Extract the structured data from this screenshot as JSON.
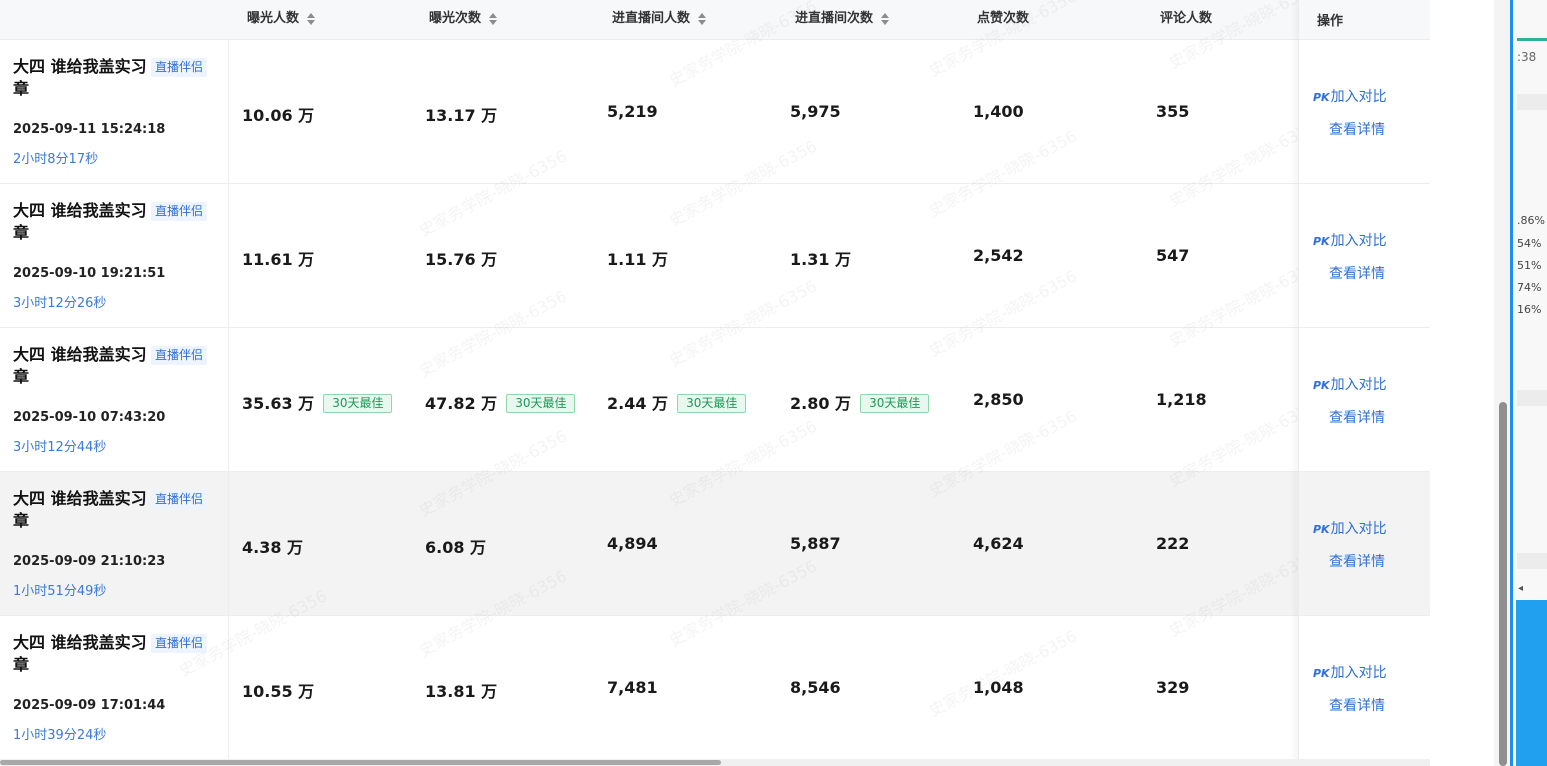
{
  "columns": {
    "exposure_users": "曝光人数",
    "exposure_count": "曝光次数",
    "enter_users": "进直播间人数",
    "enter_count": "进直播间次数",
    "likes": "点赞次数",
    "comment_users": "评论人数",
    "actions": "操作"
  },
  "rows": [
    {
      "title": "大四 谁给我盖实习章",
      "tag": "直播伴侣",
      "start_time": "2025-09-11 15:24:18",
      "duration": "2小时8分17秒",
      "exposure_users": "10.06 万",
      "exposure_count": "13.17 万",
      "enter_users": "5,219",
      "enter_count": "5,975",
      "likes": "1,400",
      "comment_users": "355"
    },
    {
      "title": "大四 谁给我盖实习章",
      "tag": "直播伴侣",
      "start_time": "2025-09-10 19:21:51",
      "duration": "3小时12分26秒",
      "exposure_users": "11.61 万",
      "exposure_count": "15.76 万",
      "enter_users": "1.11 万",
      "enter_count": "1.31 万",
      "likes": "2,542",
      "comment_users": "547"
    },
    {
      "title": "大四 谁给我盖实习章",
      "tag": "直播伴侣",
      "start_time": "2025-09-10 07:43:20",
      "duration": "3小时12分44秒",
      "exposure_users": "35.63 万",
      "exposure_count": "47.82 万",
      "enter_users": "2.44 万",
      "enter_count": "2.80 万",
      "likes": "2,850",
      "comment_users": "1,218",
      "best_badge": "30天最佳"
    },
    {
      "title": "大四 谁给我盖实习章",
      "tag": "直播伴侣",
      "start_time": "2025-09-09 21:10:23",
      "duration": "1小时51分49秒",
      "exposure_users": "4.38 万",
      "exposure_count": "6.08 万",
      "enter_users": "4,894",
      "enter_count": "5,887",
      "likes": "4,624",
      "comment_users": "222"
    },
    {
      "title": "大四 谁给我盖实习章",
      "tag": "直播伴侣",
      "start_time": "2025-09-09 17:01:44",
      "duration": "1小时39分24秒",
      "exposure_users": "10.55 万",
      "exposure_count": "13.81 万",
      "enter_users": "7,481",
      "enter_count": "8,546",
      "likes": "1,048",
      "comment_users": "329"
    }
  ],
  "actions": {
    "pk_icon_text": "PK",
    "compare_label": "加入对比",
    "detail_label": "查看详情"
  },
  "side_panel": {
    "time_fragment": ":38",
    "percents": [
      ".86%",
      "54%",
      "51%",
      "74%",
      "16%"
    ],
    "arrow": "◂"
  },
  "watermark": "史家务学院-晓晓-6356",
  "colors": {
    "link_blue": "#2f6fd6",
    "best_green": "#1a9a55",
    "hover_row": "#f3f3f3"
  }
}
